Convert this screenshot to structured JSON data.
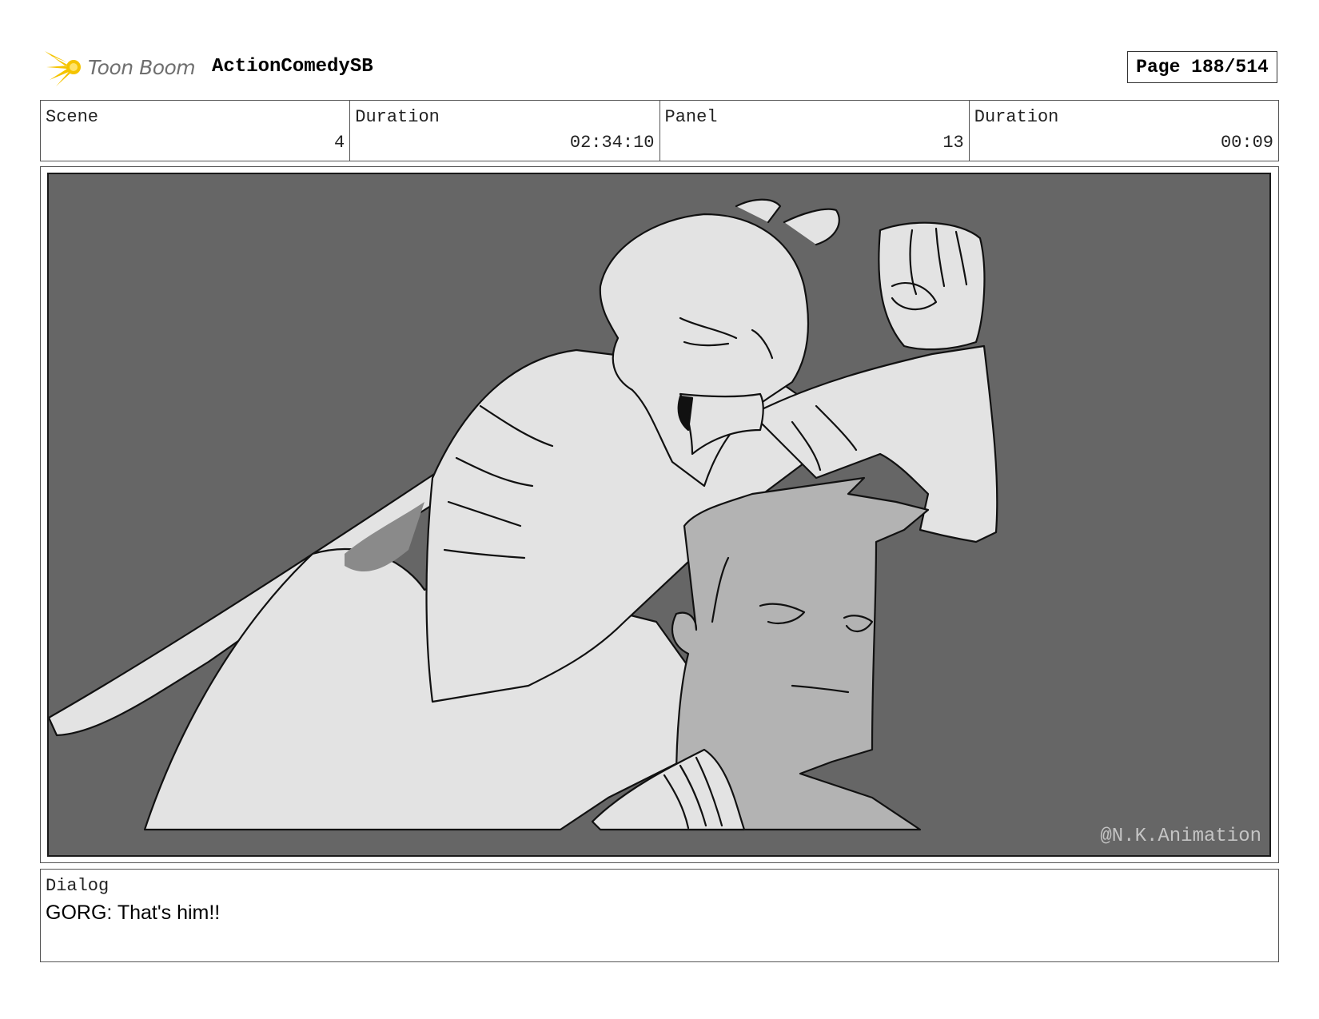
{
  "header": {
    "logo_text": "Toon Boom",
    "project_title": "ActionComedySB",
    "page": "Page 188/514"
  },
  "info": {
    "scene_label": "Scene",
    "scene_value": "4",
    "scene_duration_label": "Duration",
    "scene_duration_value": "02:34:10",
    "panel_label": "Panel",
    "panel_value": "13",
    "panel_duration_label": "Duration",
    "panel_duration_value": "00:09"
  },
  "panel": {
    "watermark": "@N.K.Animation"
  },
  "dialog": {
    "label": "Dialog",
    "text": "GORG: That's him!!"
  },
  "colors": {
    "background": "#666666",
    "figure_light": "#e3e3e3",
    "figure_mid": "#b3b3b3",
    "ink": "#111111"
  }
}
